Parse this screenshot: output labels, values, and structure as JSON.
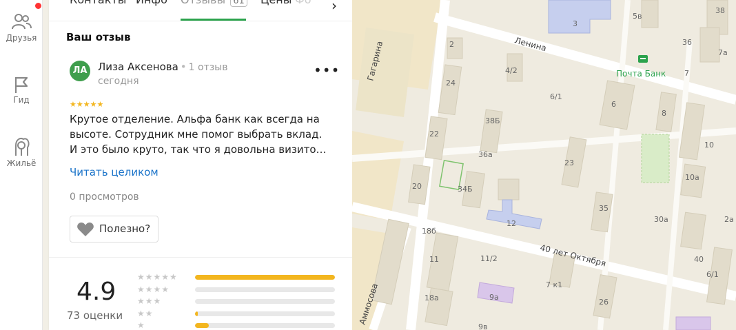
{
  "rail": {
    "friends_label": "Друзья",
    "guide_label": "Гид",
    "housing_label": "Жильё",
    "notification_color": "#ff3333"
  },
  "tabs": {
    "contacts": "Контакты",
    "info": "Инфо",
    "reviews": "Отзывы",
    "reviews_count": "61",
    "prices": "Цены",
    "photos": "Фо"
  },
  "review": {
    "section_title": "Ваш отзыв",
    "avatar_initials": "ЛА",
    "author": "Лиза Аксенова",
    "author_reviews": "1 отзыв",
    "date": "сегодня",
    "stars": "★★★★★",
    "text_lines": [
      "Крутое отделение. Альфа банк как всегда на",
      "высоте. Сотрудник мне помог выбрать вклад.",
      "И это было круто, так что я довольна визито…"
    ],
    "read_more": "Читать целиком",
    "views": "0 просмотров",
    "useful_label": "Полезно?"
  },
  "rating": {
    "value": "4.9",
    "count": "73 оценки",
    "distribution": [
      {
        "stars": "★★★★★",
        "fraction": 1.0
      },
      {
        "stars": "★★★★",
        "fraction": 0.0
      },
      {
        "stars": "★★★",
        "fraction": 0.0
      },
      {
        "stars": "★★",
        "fraction": 0.02
      },
      {
        "stars": "★",
        "fraction": 0.1
      }
    ],
    "bar_color": "#f3b61f"
  },
  "map": {
    "streets": {
      "lenina": "Ленина",
      "gagarina": "Гагарина",
      "oktyabrya": "40 лет Октября",
      "ammosova": "Аммосова"
    },
    "poi_label": "Почта Банк",
    "poi_color": "#2ba24c",
    "house_numbers": [
      "2",
      "3",
      "5в",
      "38",
      "36",
      "7а",
      "4/2",
      "24",
      "6/1",
      "6",
      "7",
      "8",
      "38Б",
      "22",
      "36а",
      "23",
      "10",
      "20",
      "34Б",
      "10а",
      "12",
      "35",
      "30а",
      "2а",
      "18б",
      "11",
      "11/2",
      "40",
      "18а",
      "9а",
      "7 к1",
      "26",
      "6/1",
      "9в"
    ]
  }
}
